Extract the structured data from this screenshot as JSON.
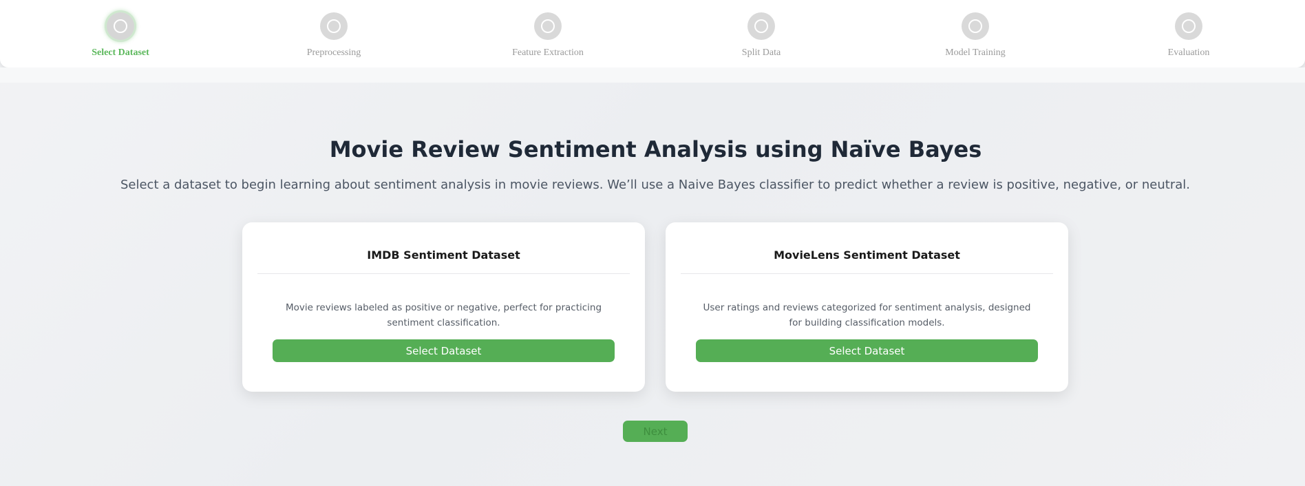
{
  "stepper": {
    "steps": [
      {
        "label": "Select Dataset",
        "active": true
      },
      {
        "label": "Preprocessing",
        "active": false
      },
      {
        "label": "Feature Extraction",
        "active": false
      },
      {
        "label": "Split Data",
        "active": false
      },
      {
        "label": "Model Training",
        "active": false
      },
      {
        "label": "Evaluation",
        "active": false
      }
    ]
  },
  "main": {
    "title": "Movie Review Sentiment Analysis using Naïve Bayes",
    "subtitle": "Select a dataset to begin learning about sentiment analysis in movie reviews. We’ll use a Naive Bayes classifier to predict whether a review is positive, negative, or neutral."
  },
  "datasets": [
    {
      "title": "IMDB Sentiment Dataset",
      "description": "Movie reviews labeled as positive or negative, perfect for practicing sentiment classification.",
      "button": "Select Dataset"
    },
    {
      "title": "MovieLens Sentiment Dataset",
      "description": "User ratings and reviews categorized for sentiment analysis, designed for building classification models.",
      "button": "Select Dataset"
    }
  ],
  "footer": {
    "next_label": "Next"
  },
  "colors": {
    "accent": "#5cb85c",
    "button": "#55ae55",
    "inactive_step": "#d9d9d9",
    "title_text": "#1f2937"
  }
}
